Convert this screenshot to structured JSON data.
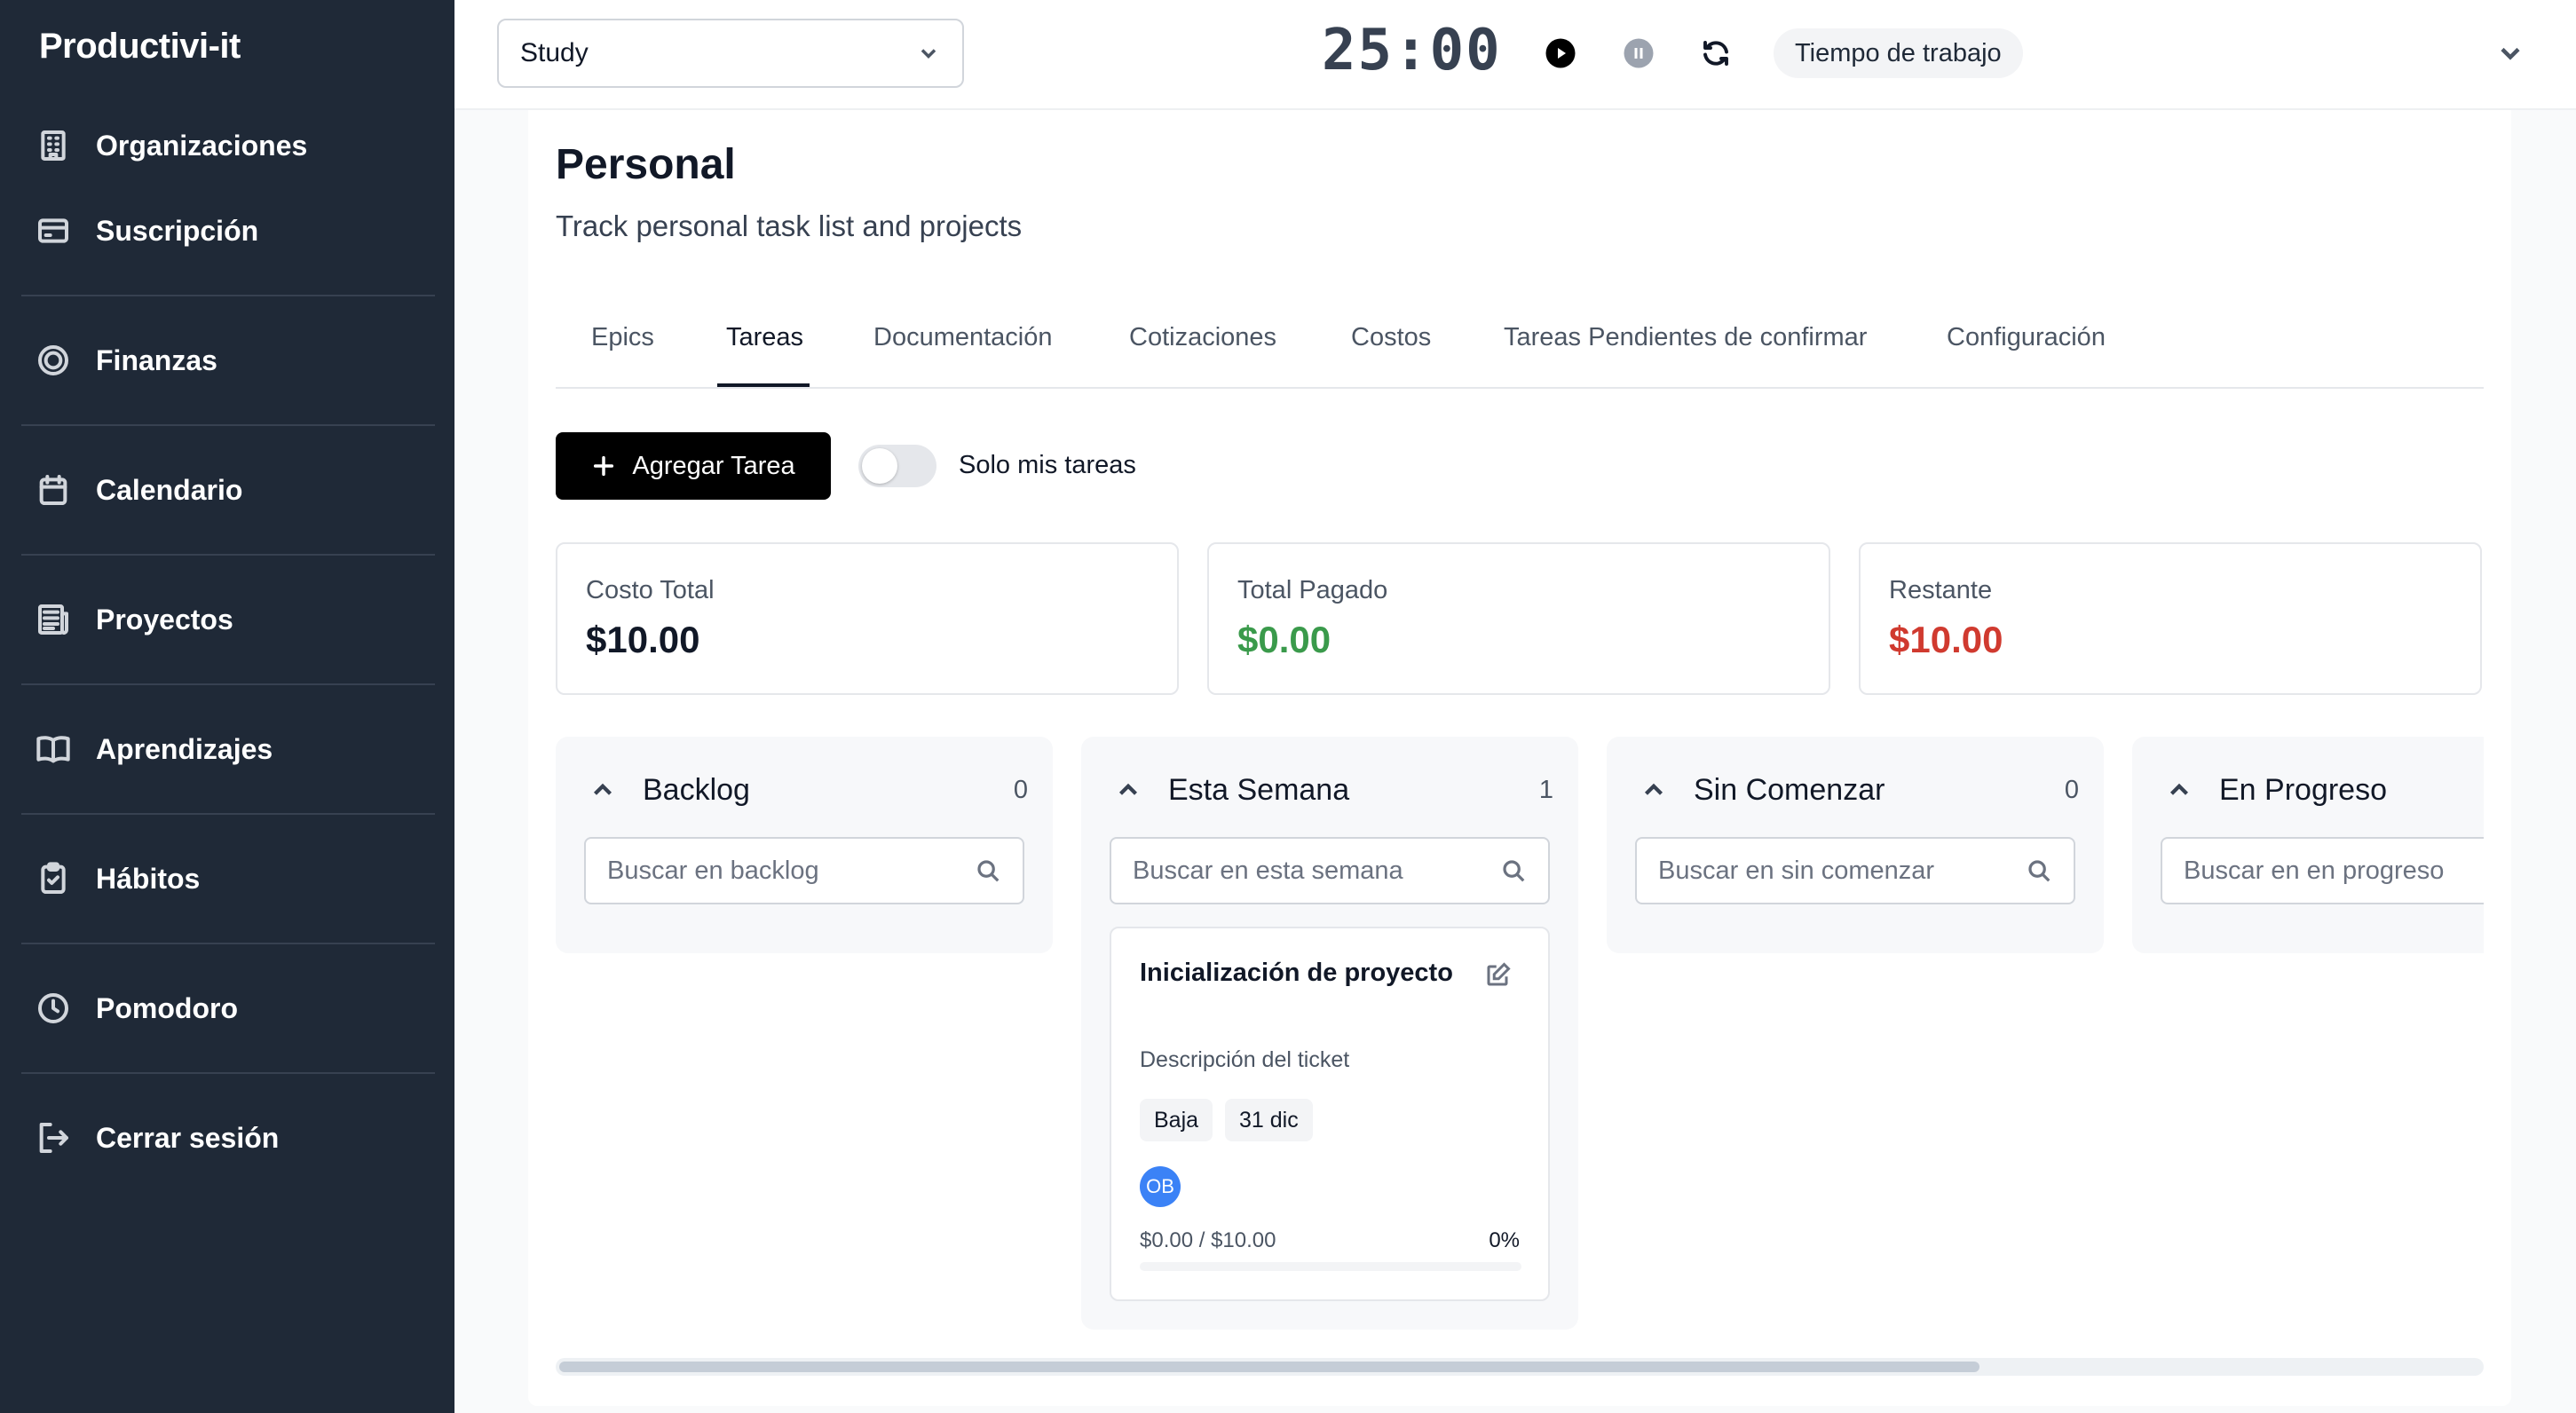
{
  "sidebar": {
    "brand": "Productivi-it",
    "items": [
      {
        "label": "Organizaciones",
        "icon": "building-icon"
      },
      {
        "label": "Suscripción",
        "icon": "credit-card-icon"
      },
      {
        "label": "Finanzas",
        "icon": "target-icon"
      },
      {
        "label": "Calendario",
        "icon": "calendar-icon"
      },
      {
        "label": "Proyectos",
        "icon": "newspaper-icon"
      },
      {
        "label": "Aprendizajes",
        "icon": "book-icon"
      },
      {
        "label": "Hábitos",
        "icon": "clipboard-check-icon"
      },
      {
        "label": "Pomodoro",
        "icon": "clock-icon"
      },
      {
        "label": "Cerrar sesión",
        "icon": "logout-icon"
      }
    ]
  },
  "topbar": {
    "project_select": "Study",
    "timer": "25:00",
    "mode": "Tiempo de trabajo"
  },
  "page": {
    "title": "Personal",
    "subtitle": "Track personal task list and projects"
  },
  "tabs": [
    {
      "label": "Epics",
      "active": false
    },
    {
      "label": "Tareas",
      "active": true
    },
    {
      "label": "Documentación",
      "active": false
    },
    {
      "label": "Cotizaciones",
      "active": false
    },
    {
      "label": "Costos",
      "active": false
    },
    {
      "label": "Tareas Pendientes de confirmar",
      "active": false
    },
    {
      "label": "Configuración",
      "active": false
    }
  ],
  "actions": {
    "add_task": "Agregar Tarea",
    "only_mine_label": "Solo mis tareas",
    "only_mine_on": false
  },
  "stats": [
    {
      "label": "Costo Total",
      "value": "$10.00",
      "color": "#111827"
    },
    {
      "label": "Total Pagado",
      "value": "$0.00",
      "color": "#3a9a4b"
    },
    {
      "label": "Restante",
      "value": "$10.00",
      "color": "#d03a2f"
    }
  ],
  "columns": [
    {
      "title": "Backlog",
      "count": "0",
      "search_placeholder": "Buscar en backlog"
    },
    {
      "title": "Esta Semana",
      "count": "1",
      "search_placeholder": "Buscar en esta semana",
      "task": {
        "title": "Inicialización de proyecto",
        "description": "Descripción del ticket",
        "priority": "Baja",
        "due": "31 dic",
        "assignee_initials": "OB",
        "amount": "$0.00 / $10.00",
        "percent": "0%",
        "progress": 0
      }
    },
    {
      "title": "Sin Comenzar",
      "count": "0",
      "search_placeholder": "Buscar en sin comenzar"
    },
    {
      "title": "En Progreso",
      "count": "",
      "search_placeholder": "Buscar en en progreso"
    }
  ]
}
